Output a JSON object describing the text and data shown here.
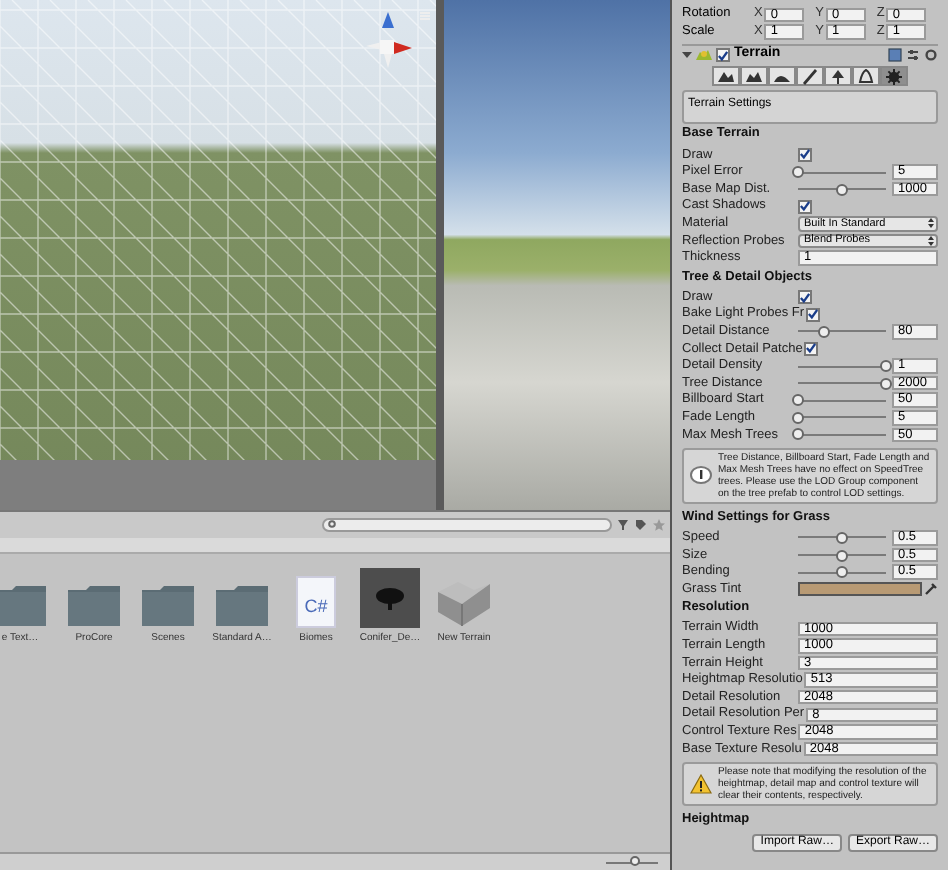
{
  "project": {
    "items": [
      {
        "kind": "folder",
        "label": "e Text…"
      },
      {
        "kind": "folder",
        "label": "ProCore"
      },
      {
        "kind": "folder",
        "label": "Scenes"
      },
      {
        "kind": "folder",
        "label": "Standard A…"
      },
      {
        "kind": "script",
        "label": "Biomes",
        "icon_text": "C#"
      },
      {
        "kind": "prefab",
        "label": "Conifer_De…"
      },
      {
        "kind": "terrain",
        "label": "New Terrain"
      }
    ],
    "zoom": {
      "level": 0.55
    }
  },
  "inspector": {
    "transform": [
      {
        "label": "Rotation",
        "axes": [
          {
            "axis": "X",
            "value": "0"
          },
          {
            "axis": "Y",
            "value": "0"
          },
          {
            "axis": "Z",
            "value": "0"
          }
        ]
      },
      {
        "label": "Scale",
        "axes": [
          {
            "axis": "X",
            "value": "1"
          },
          {
            "axis": "Y",
            "value": "1"
          },
          {
            "axis": "Z",
            "value": "1"
          }
        ]
      }
    ],
    "component": {
      "title": "Terrain",
      "enabled": true,
      "expanded": true
    },
    "tools": [
      {
        "kind": "raise",
        "selected": false
      },
      {
        "kind": "paint-height",
        "selected": false
      },
      {
        "kind": "smooth",
        "selected": false
      },
      {
        "kind": "texture",
        "selected": false
      },
      {
        "kind": "tree",
        "selected": false
      },
      {
        "kind": "detail",
        "selected": false
      },
      {
        "kind": "settings",
        "selected": true
      }
    ],
    "tool_label": "Terrain Settings",
    "rows": [
      {
        "kind": "header",
        "label": "Base Terrain"
      },
      {
        "kind": "checkbox",
        "label": "Draw",
        "checked": true
      },
      {
        "kind": "slider",
        "label": "Pixel Error",
        "level": 0.0,
        "value": "5"
      },
      {
        "kind": "slider",
        "label": "Base Map Dist.",
        "level": 0.5,
        "value": "1000"
      },
      {
        "kind": "checkbox",
        "label": "Cast Shadows",
        "checked": true
      },
      {
        "kind": "dropdown",
        "label": "Material",
        "value": "Built In Standard"
      },
      {
        "kind": "dropdown",
        "label": "Reflection Probes",
        "value": "Blend Probes"
      },
      {
        "kind": "field",
        "label": "Thickness",
        "value": "1"
      },
      {
        "kind": "header",
        "label": "Tree & Detail Objects"
      },
      {
        "kind": "checkbox",
        "label": "Draw",
        "checked": true
      },
      {
        "kind": "checkbox",
        "label": "Bake Light Probes Fr",
        "checked": true
      },
      {
        "kind": "slider",
        "label": "Detail Distance",
        "level": 0.3,
        "value": "80"
      },
      {
        "kind": "checkbox",
        "label": "Collect Detail Patche",
        "checked": true
      },
      {
        "kind": "slider",
        "label": "Detail Density",
        "level": 1.0,
        "value": "1"
      },
      {
        "kind": "slider",
        "label": "Tree Distance",
        "level": 1.0,
        "value": "2000"
      },
      {
        "kind": "slider",
        "label": "Billboard Start",
        "level": 0.0,
        "value": "50"
      },
      {
        "kind": "slider",
        "label": "Fade Length",
        "level": 0.0,
        "value": "5"
      },
      {
        "kind": "slider",
        "label": "Max Mesh Trees",
        "level": 0.0,
        "value": "50"
      },
      {
        "kind": "info",
        "label": "Tree Distance, Billboard Start, Fade Length and Max Mesh Trees have no effect on SpeedTree trees. Please use the LOD Group component on the tree prefab to control LOD settings."
      },
      {
        "kind": "header",
        "label": "Wind Settings for Grass"
      },
      {
        "kind": "slider",
        "label": "Speed",
        "level": 0.5,
        "value": "0.5"
      },
      {
        "kind": "slider",
        "label": "Size",
        "level": 0.5,
        "value": "0.5"
      },
      {
        "kind": "slider",
        "label": "Bending",
        "level": 0.5,
        "value": "0.5"
      },
      {
        "kind": "color",
        "label": "Grass Tint",
        "color": "#b89a74"
      },
      {
        "kind": "header",
        "label": "Resolution"
      },
      {
        "kind": "field",
        "label": "Terrain Width",
        "value": "1000"
      },
      {
        "kind": "field",
        "label": "Terrain Length",
        "value": "1000"
      },
      {
        "kind": "field",
        "label": "Terrain Height",
        "value": "3"
      },
      {
        "kind": "field",
        "label": "Heightmap Resolutio",
        "value": "513"
      },
      {
        "kind": "field",
        "label": "Detail Resolution",
        "value": "2048"
      },
      {
        "kind": "field",
        "label": "Detail Resolution Per",
        "value": "8"
      },
      {
        "kind": "field",
        "label": "Control Texture Res",
        "value": "2048"
      },
      {
        "kind": "field",
        "label": "Base Texture Resolu",
        "value": "2048"
      },
      {
        "kind": "warning",
        "label": "Please note that modifying the resolution of the heightmap, detail map and control texture will clear their contents, respectively."
      },
      {
        "kind": "header",
        "label": "Heightmap"
      },
      {
        "kind": "buttons",
        "buttons": [
          "Import Raw…",
          "Export Raw…"
        ]
      }
    ]
  }
}
